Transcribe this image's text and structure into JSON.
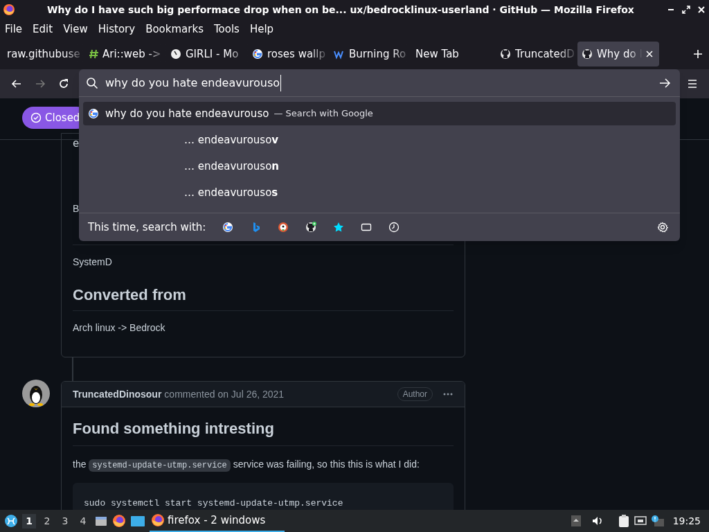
{
  "window": {
    "title": "Why do I have such big performace drop when on be... ux/bedrocklinux-userland · GitHub — Mozilla Firefox"
  },
  "menu": [
    "File",
    "Edit",
    "View",
    "History",
    "Bookmarks",
    "Tools",
    "Help"
  ],
  "tabs": [
    {
      "label": "raw.githubuse",
      "kind": "plain",
      "selected": false
    },
    {
      "label": "Ari::web ->",
      "kind": "hash",
      "selected": false
    },
    {
      "label": "GIRLI - Mo",
      "kind": "clock",
      "selected": false
    },
    {
      "label": "roses wallp",
      "kind": "google",
      "selected": false
    },
    {
      "label": "Burning Ro",
      "kind": "wave",
      "selected": false
    },
    {
      "label": "New Tab",
      "kind": "plain",
      "selected": false
    },
    {
      "label": "TruncatedD",
      "kind": "github",
      "selected": false
    },
    {
      "label": "Why do I",
      "kind": "github",
      "selected": true
    }
  ],
  "urlbar": {
    "value": "why do you hate endeavurouso"
  },
  "suggestions": [
    {
      "kind": "search",
      "text": "why do you hate endeavurouso",
      "hint": "— Search with Google",
      "selected": true
    },
    {
      "kind": "tail",
      "text": "… endeavurouso**v**",
      "selected": false
    },
    {
      "kind": "tail",
      "text": "… endeavurouso**n**",
      "selected": false
    },
    {
      "kind": "tail",
      "text": "… endeavurouso**s**",
      "selected": false
    }
  ],
  "search_with": {
    "label": "This time, search with:",
    "engines": [
      {
        "kind": "google"
      },
      {
        "kind": "bing"
      },
      {
        "kind": "duck"
      },
      {
        "kind": "github"
      },
      {
        "kind": "bookmarks"
      },
      {
        "kind": "tabs"
      },
      {
        "kind": "history"
      }
    ]
  },
  "page": {
    "status_badge": "Closed",
    "first_comment": {
      "fragments": [
        "e",
        "B"
      ],
      "sections": [
        {
          "body": "SystemD"
        },
        {
          "heading": "Converted from",
          "body": "Arch linux -> Bedrock"
        }
      ]
    },
    "second_comment": {
      "author": "TruncatedDinosour",
      "meta": "commented on Jul 26, 2021",
      "role": "Author",
      "heading": "Found something intresting",
      "paragraph_start": "the",
      "inline_code": "systemd-update-utmp.service",
      "paragraph_end": "service was failing, so this this is what I did:",
      "code": "sudo systemctl start systemd-update-utmp.service"
    }
  },
  "taskbar": {
    "workspaces": [
      {
        "label": "1",
        "selected": true
      },
      {
        "label": "2",
        "selected": false
      },
      {
        "label": "3",
        "selected": false
      },
      {
        "label": "4",
        "selected": false
      }
    ],
    "task": "firefox - 2 windows",
    "clock": "19:25"
  }
}
